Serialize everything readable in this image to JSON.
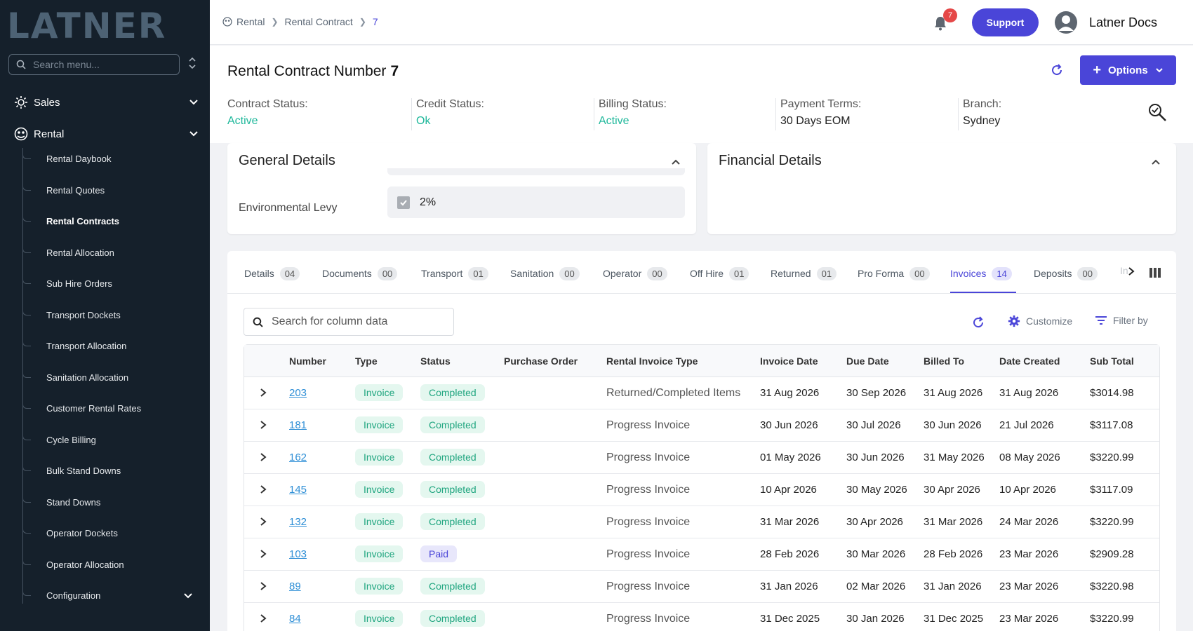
{
  "sidebar": {
    "logo": "LATNER",
    "search_placeholder": "Search menu...",
    "sections": [
      {
        "label": "Sales"
      },
      {
        "label": "Rental"
      }
    ],
    "rental_items": [
      {
        "label": "Rental Daybook"
      },
      {
        "label": "Rental Quotes"
      },
      {
        "label": "Rental Contracts"
      },
      {
        "label": "Rental Allocation"
      },
      {
        "label": "Sub Hire Orders"
      },
      {
        "label": "Transport Dockets"
      },
      {
        "label": "Transport Allocation"
      },
      {
        "label": "Sanitation Allocation"
      },
      {
        "label": "Customer Rental Rates"
      },
      {
        "label": "Cycle Billing"
      },
      {
        "label": "Bulk Stand Downs"
      },
      {
        "label": "Stand Downs"
      },
      {
        "label": "Operator Dockets"
      },
      {
        "label": "Operator Allocation"
      },
      {
        "label": "Configuration"
      }
    ]
  },
  "topbar": {
    "breadcrumb": [
      "Rental",
      "Rental Contract",
      "7"
    ],
    "notifications": "7",
    "support_label": "Support",
    "user_name": "Latner Docs"
  },
  "header": {
    "title": "Rental Contract Number",
    "number": "7",
    "options_label": "Options",
    "statuses": [
      {
        "label": "Contract Status:",
        "value": "Active"
      },
      {
        "label": "Credit Status:",
        "value": "Ok"
      },
      {
        "label": "Billing Status:",
        "value": "Active"
      },
      {
        "label": "Payment Terms:",
        "value": "30 Days EOM"
      },
      {
        "label": "Branch:",
        "value": "Sydney"
      }
    ]
  },
  "general": {
    "title": "General Details",
    "levy_label": "Environmental Levy",
    "levy_value": "2%"
  },
  "financial": {
    "title": "Financial Details"
  },
  "tabs": [
    {
      "label": "Details",
      "count": "04"
    },
    {
      "label": "Documents",
      "count": "00"
    },
    {
      "label": "Transport",
      "count": "01"
    },
    {
      "label": "Sanitation",
      "count": "00"
    },
    {
      "label": "Operator",
      "count": "00"
    },
    {
      "label": "Off Hire",
      "count": "01"
    },
    {
      "label": "Returned",
      "count": "01"
    },
    {
      "label": "Pro Forma",
      "count": "00"
    },
    {
      "label": "Invoices",
      "count": "14"
    },
    {
      "label": "Deposits",
      "count": "00"
    }
  ],
  "tabs_overflow_text": "In",
  "toolbar": {
    "search_placeholder": "Search for column data",
    "customize_label": "Customize",
    "filter_label": "Filter by"
  },
  "table": {
    "columns": [
      "Number",
      "Type",
      "Status",
      "Purchase Order",
      "Rental Invoice Type",
      "Invoice Date",
      "Due Date",
      "Billed To",
      "Date Created",
      "Sub Total"
    ],
    "rows": [
      {
        "number": "203",
        "type": "Invoice",
        "status": "Completed",
        "po": "",
        "rit": "Returned/Completed Items",
        "invoice_date": "31 Aug 2026",
        "due_date": "30 Sep 2026",
        "billed_to": "31 Aug 2026",
        "date_created": "31 Aug 2026",
        "sub_total": "$3014.98"
      },
      {
        "number": "181",
        "type": "Invoice",
        "status": "Completed",
        "po": "",
        "rit": "Progress Invoice",
        "invoice_date": "30 Jun 2026",
        "due_date": "30 Jul 2026",
        "billed_to": "30 Jun 2026",
        "date_created": "21 Jul 2026",
        "sub_total": "$3117.08"
      },
      {
        "number": "162",
        "type": "Invoice",
        "status": "Completed",
        "po": "",
        "rit": "Progress Invoice",
        "invoice_date": "01 May 2026",
        "due_date": "30 Jun 2026",
        "billed_to": "31 May 2026",
        "date_created": "08 May 2026",
        "sub_total": "$3220.99"
      },
      {
        "number": "145",
        "type": "Invoice",
        "status": "Completed",
        "po": "",
        "rit": "Progress Invoice",
        "invoice_date": "10 Apr 2026",
        "due_date": "30 May 2026",
        "billed_to": "30 Apr 2026",
        "date_created": "10 Apr 2026",
        "sub_total": "$3117.09"
      },
      {
        "number": "132",
        "type": "Invoice",
        "status": "Completed",
        "po": "",
        "rit": "Progress Invoice",
        "invoice_date": "31 Mar 2026",
        "due_date": "30 Apr 2026",
        "billed_to": "31 Mar 2026",
        "date_created": "24 Mar 2026",
        "sub_total": "$3220.99"
      },
      {
        "number": "103",
        "type": "Invoice",
        "status": "Paid",
        "po": "",
        "rit": "Progress Invoice",
        "invoice_date": "28 Feb 2026",
        "due_date": "30 Mar 2026",
        "billed_to": "28 Feb 2026",
        "date_created": "23 Mar 2026",
        "sub_total": "$2909.28"
      },
      {
        "number": "89",
        "type": "Invoice",
        "status": "Completed",
        "po": "",
        "rit": "Progress Invoice",
        "invoice_date": "31 Jan 2026",
        "due_date": "02 Mar 2026",
        "billed_to": "31 Jan 2026",
        "date_created": "23 Mar 2026",
        "sub_total": "$3220.98"
      },
      {
        "number": "84",
        "type": "Invoice",
        "status": "Completed",
        "po": "",
        "rit": "Progress Invoice",
        "invoice_date": "31 Dec 2025",
        "due_date": "30 Jan 2026",
        "billed_to": "31 Dec 2025",
        "date_created": "23 Mar 2026",
        "sub_total": "$3220.99"
      }
    ]
  },
  "colors": {
    "accent": "#4a45d8",
    "success": "#1fb89b",
    "sidebar_bg": "#15202b"
  }
}
